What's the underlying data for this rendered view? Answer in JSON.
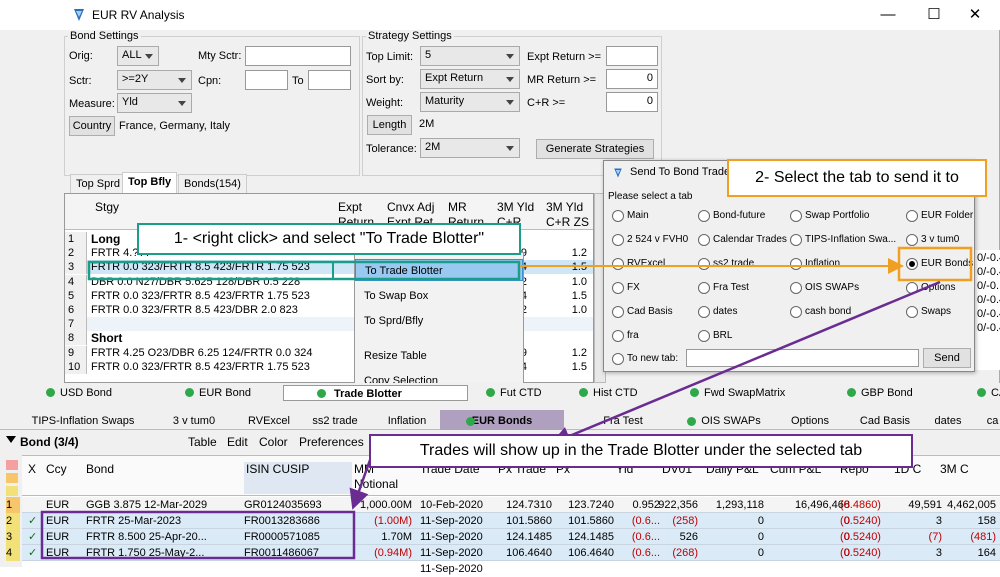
{
  "window": {
    "title": "EUR RV Analysis"
  },
  "bond_settings": {
    "title": "Bond Settings",
    "orig_label": "Orig:",
    "orig_value": "ALL",
    "sctr_label": "Sctr:",
    "sctr_value": ">=2Y",
    "measure_label": "Measure:",
    "measure_value": "Yld",
    "mty_sctr_label": "Mty Sctr:",
    "cpn_label": "Cpn:",
    "to_label": "To",
    "country_button": "Country",
    "country_value": "France, Germany, Italy"
  },
  "strategy_settings": {
    "title": "Strategy Settings",
    "top_limit_label": "Top Limit:",
    "top_limit_value": "5",
    "sort_by_label": "Sort by:",
    "sort_by_value": "Expt Return",
    "weight_label": "Weight:",
    "weight_value": "Maturity",
    "length_button": "Length",
    "length_value": "2M",
    "tolerance_label": "Tolerance:",
    "tolerance_value": "2M",
    "expt_return_label": "Expt Return >=",
    "mr_return_label": "MR Return >=",
    "mr_return_value": "0",
    "cr_label": "C+R >=",
    "cr_value": "0",
    "generate_button": "Generate Strategies"
  },
  "top_tabs": [
    "Top Sprd",
    "Top Bfly",
    "Bonds(154)"
  ],
  "strategy_grid": {
    "headers": [
      "Stgy",
      "Expt Return",
      "Cnvx Adj Expt Ret",
      "MR Return",
      "3M Yld C+R",
      "3M Yld C+R ZS"
    ],
    "rows": [
      {
        "n": "1",
        "name": "Long",
        "v1": "",
        "v2": "",
        "bold": true
      },
      {
        "n": "2",
        "name": "FRTR 4.???",
        "v1": "1.9",
        "v2": "1.2"
      },
      {
        "n": "3",
        "name": "FRTR 0.0 323/FRTR 8.5 423/FRTR 1.75 523",
        "v1": ".4",
        "v2": "1.5"
      },
      {
        "n": "4",
        "name": "DBR 0.0 N27/DBR 5.625 128/DBR 0.5 228",
        "v1": "0.2",
        "v2": "1.0"
      },
      {
        "n": "5",
        "name": "FRTR 0.0 323/FRTR 8.5 423/FRTR 1.75 523",
        "v1": "0.4",
        "v2": "1.5"
      },
      {
        "n": "6",
        "name": "FRTR 0.0 323/FRTR 8.5 423/DBR 2.0 823",
        "v1": "0.2",
        "v2": "1.0"
      },
      {
        "n": "7",
        "name": "",
        "v1": "",
        "v2": ""
      },
      {
        "n": "8",
        "name": "Short",
        "v1": "",
        "v2": "",
        "bold": true
      },
      {
        "n": "9",
        "name": "FRTR 4.25 O23/DBR 6.25 124/FRTR 0.0 324",
        "v1": "1.9",
        "v2": "1.2"
      },
      {
        "n": "10",
        "name": "FRTR 0.0 323/FRTR 8.5 423/FRTR 1.75 523",
        "v1": "0.4",
        "v2": "1.5"
      }
    ]
  },
  "context_menu": [
    "To Trade Blotter",
    "To Swap Box",
    "To Sprd/Bfly",
    "Resize Table",
    "Copy Selection"
  ],
  "send_dialog": {
    "title": "Send To Bond Trade",
    "prompt": "Please select a tab",
    "options": [
      [
        "Main",
        "Bond-future",
        "Swap Portfolio",
        "EUR Folder"
      ],
      [
        "2 524 v FVH0",
        "Calendar Trades",
        "TIPS-Inflation Swa...",
        "3 v tum0"
      ],
      [
        "RVExcel",
        "ss2 trade",
        "Inflation",
        "EUR Bonds"
      ],
      [
        "FX",
        "Fra Test",
        "OIS SWAPs",
        "Options"
      ],
      [
        "Cad Basis",
        "dates",
        "cash bond",
        "Swaps"
      ],
      [
        "fra",
        "BRL",
        "",
        ""
      ]
    ],
    "new_tab_label": "To new tab:",
    "send_button": "Send"
  },
  "callouts": {
    "step1": "1- <right click> and select \"To Trade Blotter\"",
    "step2": "2- Select the tab to send it to",
    "step3": "Trades will show up in the Trade Blotter under the selected tab"
  },
  "right_partial": [
    "0/-0.4",
    "0/-0.4",
    "0/-0.",
    "0/-0.4",
    "0/-0.4",
    "0/-0.4"
  ],
  "bottom_tabs": [
    "USD Bond",
    "EUR Bond",
    "Trade Blotter",
    "Fut CTD",
    "Hist CTD",
    "Fwd SwapMatrix",
    "GBP Bond",
    "CA"
  ],
  "blotter_tabs": [
    "TIPS-Inflation Swaps",
    "3 v tum0",
    "RVExcel",
    "ss2 trade",
    "Inflation",
    "EUR Bonds",
    "Fra Test",
    "OIS SWAPs",
    "Options",
    "Cad Basis",
    "dates",
    "ca"
  ],
  "blotter_toolbar": {
    "title": "Bond (3/4)",
    "menu": [
      "Table",
      "Edit",
      "Color",
      "Preferences"
    ]
  },
  "blotter": {
    "headers": [
      "X",
      "Ccy",
      "Bond",
      "ISIN CUSIP",
      "MM Notional",
      "Trade Date",
      "Px Trade",
      "Px",
      "Yld",
      "DV01",
      "Daily P&L",
      "Cum P&L",
      "Repo",
      "1D C",
      "3M C"
    ],
    "rows": [
      {
        "n": "1",
        "check": "",
        "ccy": "EUR",
        "bond": "GGB 3.875 12-Mar-2029",
        "isin": "GR0124035693",
        "notional": "1,000.00M",
        "date": "10-Feb-2020",
        "pxt": "124.7310",
        "px": "123.7240",
        "yld": "0.952",
        "dv01": "922,356",
        "daily": "1,293,118",
        "cum": "16,496,468",
        "repo": "(0.4860)",
        "d1": "49,591",
        "m3": "4,462,005"
      },
      {
        "n": "2",
        "check": "✓",
        "ccy": "EUR",
        "bond": "FRTR 25-Mar-2023",
        "isin": "FR0013283686",
        "notional": "(1.00M)",
        "date": "11-Sep-2020",
        "pxt": "101.5860",
        "px": "101.5860",
        "yld": "(0.6...",
        "dv01": "(258)",
        "daily": "0",
        "cum": "0",
        "repo": "(0.5240)",
        "d1": "3",
        "m3": "158"
      },
      {
        "n": "3",
        "check": "✓",
        "ccy": "EUR",
        "bond": "FRTR 8.500 25-Apr-20...",
        "isin": "FR0000571085",
        "notional": "1.70M",
        "date": "11-Sep-2020",
        "pxt": "124.1485",
        "px": "124.1485",
        "yld": "(0.6...",
        "dv01": "526",
        "daily": "0",
        "cum": "0",
        "repo": "(0.5240)",
        "d1": "(7)",
        "m3": "(481)"
      },
      {
        "n": "4",
        "check": "✓",
        "ccy": "EUR",
        "bond": "FRTR 1.750 25-May-2...",
        "isin": "FR0011486067",
        "notional": "(0.94M)",
        "date": "11-Sep-2020",
        "pxt": "106.4640",
        "px": "106.4640",
        "yld": "(0.6...",
        "dv01": "(268)",
        "daily": "0",
        "cum": "0",
        "repo": "(0.5240)",
        "d1": "3",
        "m3": "164"
      }
    ],
    "last_date": "11-Sep-2020"
  }
}
